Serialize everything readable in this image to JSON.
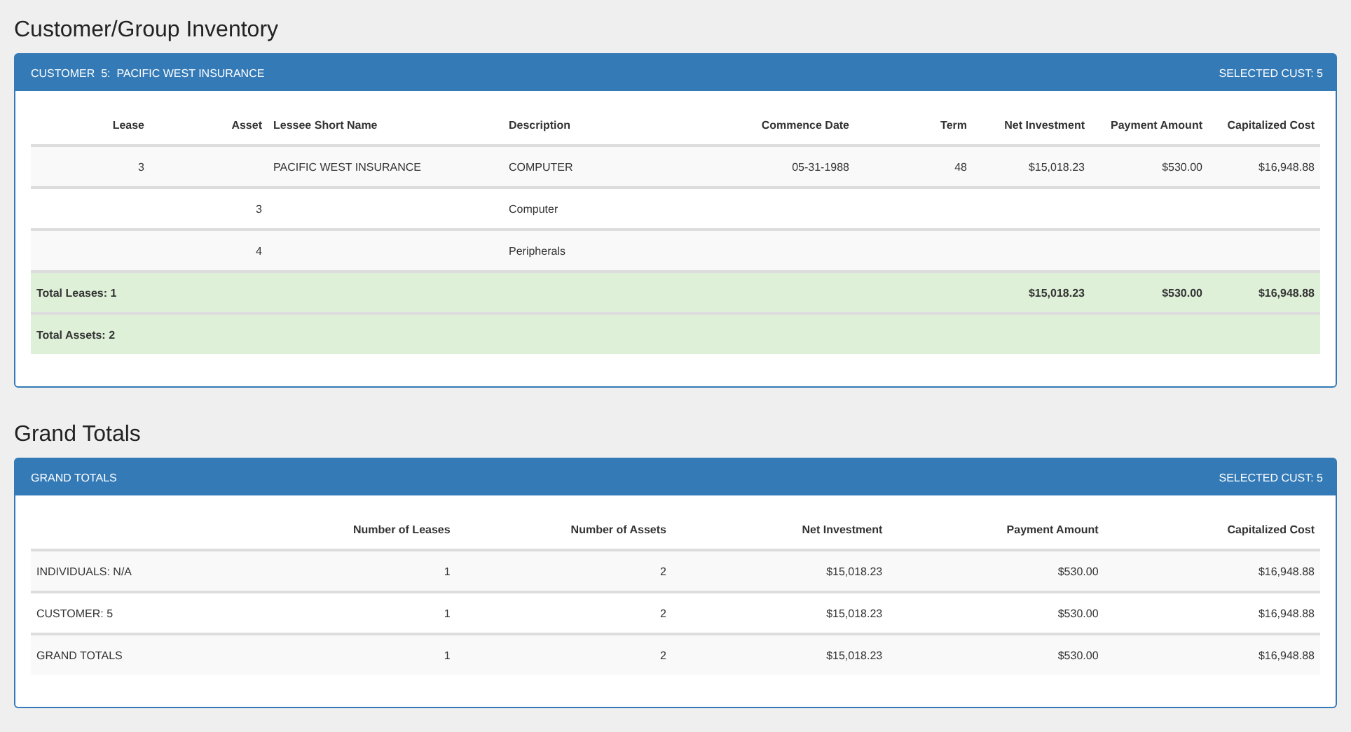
{
  "inventory": {
    "title": "Customer/Group Inventory",
    "panel_heading": "CUSTOMER  5:  PACIFIC WEST INSURANCE",
    "selected_cust": "SELECTED CUST: 5",
    "columns": [
      "Lease",
      "Asset",
      "Lessee Short Name",
      "Description",
      "Commence Date",
      "Term",
      "Net Investment",
      "Payment Amount",
      "Capitalized Cost"
    ],
    "rows": [
      {
        "kind": "lease",
        "lease": "3",
        "lessee_short_name": "PACIFIC WEST INSURANCE",
        "description": "COMPUTER",
        "commence_date": "05-31-1988",
        "term": "48",
        "net_investment": "$15,018.23",
        "payment_amount": "$530.00",
        "capitalized_cost": "$16,948.88"
      },
      {
        "kind": "asset",
        "asset": "3",
        "description": "Computer"
      },
      {
        "kind": "asset",
        "asset": "4",
        "description": "Peripherals"
      },
      {
        "kind": "total",
        "label": "Total Leases: 1",
        "net_investment": "$15,018.23",
        "payment_amount": "$530.00",
        "capitalized_cost": "$16,948.88"
      },
      {
        "kind": "total",
        "label": "Total Assets: 2"
      }
    ]
  },
  "grand_totals": {
    "title": "Grand Totals",
    "panel_heading": "GRAND TOTALS",
    "selected_cust": "SELECTED CUST: 5",
    "columns": [
      "",
      "Number of Leases",
      "Number of Assets",
      "Net Investment",
      "Payment Amount",
      "Capitalized Cost"
    ],
    "rows": [
      [
        "INDIVIDUALS: N/A",
        "1",
        "2",
        "$15,018.23",
        "$530.00",
        "$16,948.88"
      ],
      [
        "CUSTOMER: 5",
        "1",
        "2",
        "$15,018.23",
        "$530.00",
        "$16,948.88"
      ],
      [
        "GRAND TOTALS",
        "1",
        "2",
        "$15,018.23",
        "$530.00",
        "$16,948.88"
      ]
    ]
  }
}
